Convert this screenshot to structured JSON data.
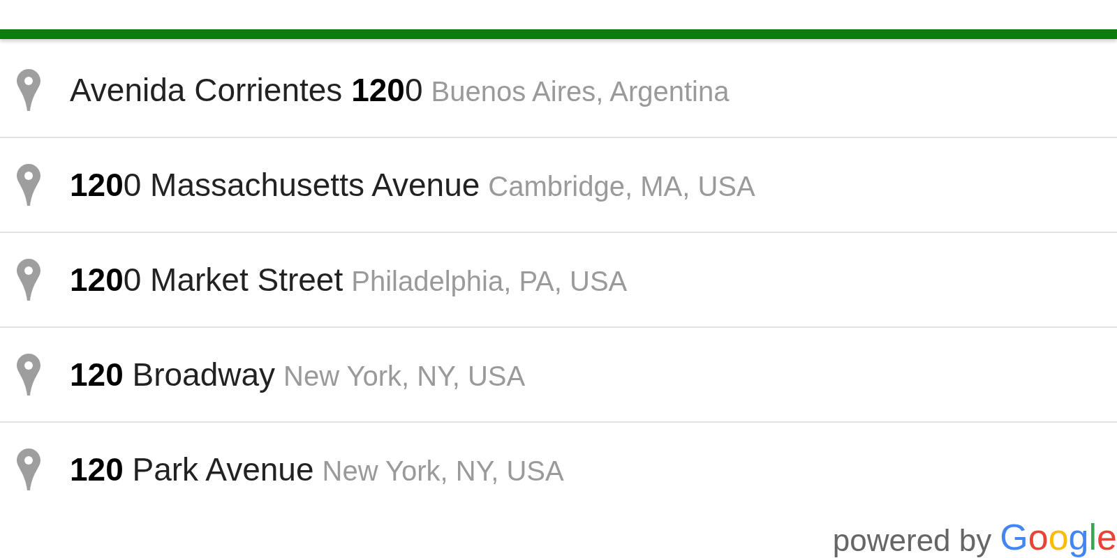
{
  "suggestions": [
    {
      "main": "Avenida Corrientes **120**0",
      "secondary": "Buenos Aires, Argentina"
    },
    {
      "main": "**120**0 Massachusetts Avenue",
      "secondary": "Cambridge, MA, USA"
    },
    {
      "main": "**120**0 Market Street",
      "secondary": "Philadelphia, PA, USA"
    },
    {
      "main": "**120** Broadway",
      "secondary": "New York, NY, USA"
    },
    {
      "main": "**120** Park Avenue",
      "secondary": "New York, NY, USA"
    }
  ],
  "footer": {
    "attribution": "powered by",
    "logo": "Google"
  }
}
